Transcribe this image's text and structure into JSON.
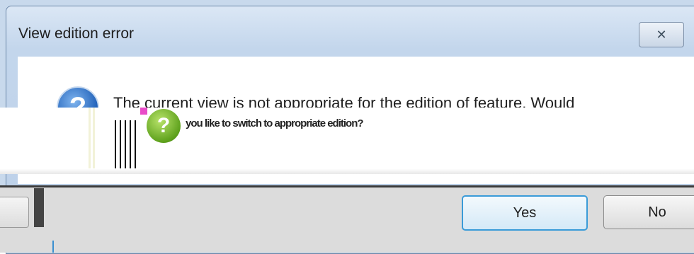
{
  "dialog": {
    "title": "View edition error",
    "close_symbol": "✕",
    "icon": "help-question-icon",
    "message_line1": "The current view is not appropriate for the edition of feature. Would",
    "message_line2": "you like to switch to appropriate edition?",
    "buttons": {
      "yes_label": "Yes",
      "no_label": "No"
    }
  },
  "colors": {
    "title_bar": "#c3d6ec",
    "focus_border": "#3a9bd8",
    "button_strip": "#dcdcdc"
  }
}
